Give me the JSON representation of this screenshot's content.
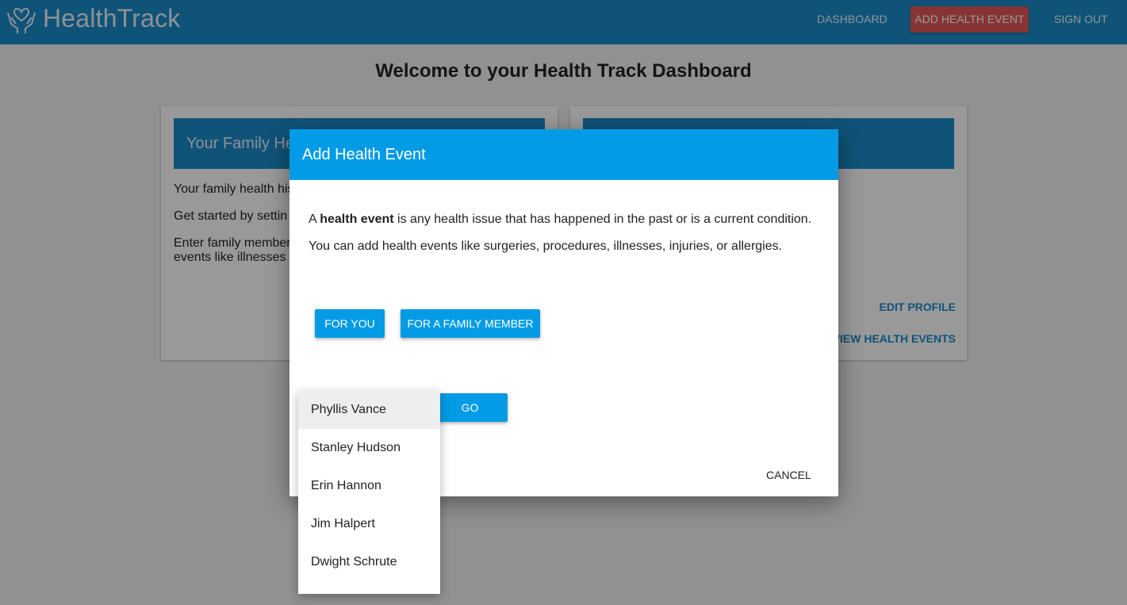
{
  "app": {
    "brand": "HealthTrack",
    "nav": {
      "dashboard": "DASHBOARD",
      "add_event": "ADD HEALTH EVENT",
      "sign_out": "SIGN OUT"
    }
  },
  "page": {
    "title": "Welcome to your Health Track Dashboard"
  },
  "left_card": {
    "header": "Your Family He",
    "line1": "Your family health his",
    "line2": "Get started by settin",
    "line3": "Enter family member",
    "line4": "events like illnesses"
  },
  "right_card": {
    "edit_profile": "EDIT PROFILE",
    "view_events": "VIEW HEALTH EVENTS"
  },
  "dialog": {
    "title": "Add Health Event",
    "p1_prefix": "A ",
    "p1_bold": "health event",
    "p1_suffix": " is any health issue that has happened in the past or is a current condition.",
    "p2": "You can add health events like surgeries, procedures, illnesses, injuries, or allergies.",
    "for_you": "FOR YOU",
    "for_family": "FOR A FAMILY MEMBER",
    "go": "GO",
    "cancel": "CANCEL"
  },
  "dropdown": {
    "selected": "Phyllis Vance",
    "options": [
      "Phyllis Vance",
      "Stanley Hudson",
      "Erin Hannon",
      "Jim Halpert",
      "Dwight Schrute"
    ]
  },
  "colors": {
    "primary": "#1b8bc9",
    "dialog_primary": "#039be5",
    "accent": "#e25858"
  }
}
